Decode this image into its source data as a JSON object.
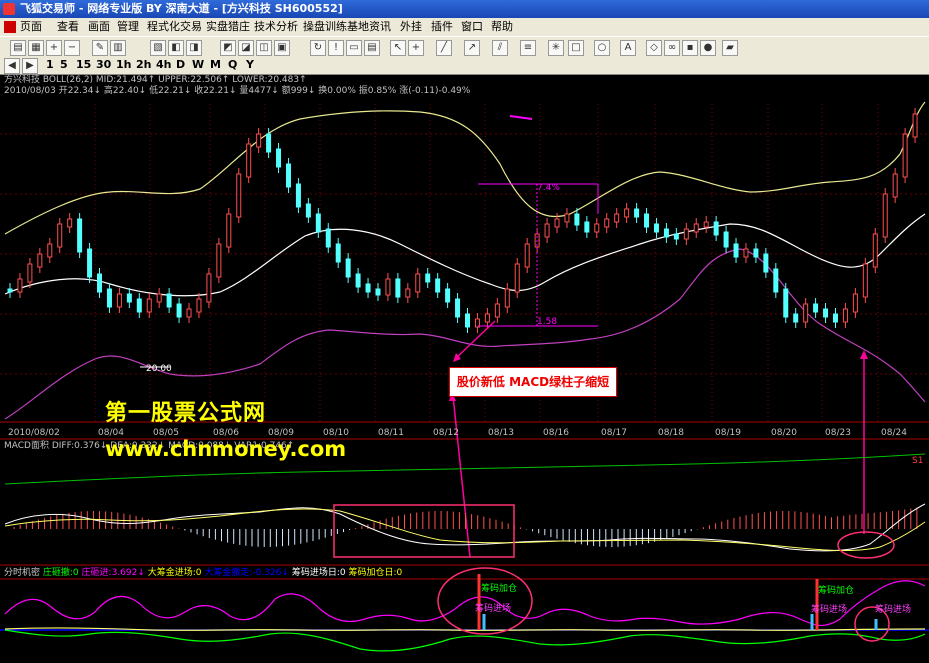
{
  "window": {
    "title": "飞狐交易师 - 网络专业版 BY 深南大道 - [方兴科技 SH600552]"
  },
  "menu": [
    "页面",
    "查看",
    "画面",
    "管理",
    "程式化交易",
    "实盘猎庄",
    "技术分析",
    "操盘训练基地",
    "资讯",
    "外挂",
    "插件",
    "窗口",
    "帮助"
  ],
  "toolbar": {
    "periods": [
      "1",
      "5",
      "15",
      "30",
      "1h",
      "2h",
      "4h",
      "D",
      "W",
      "M",
      "Q",
      "Y"
    ],
    "buttons": [
      "open-icon",
      "print-icon",
      "zoom-in-icon",
      "zoom-out-icon",
      "drawing-icon",
      "cursor-icon",
      "line-icon",
      "text-icon",
      "rect-icon",
      "ellipse-icon",
      "font-icon",
      "eraser-icon",
      "save-icon"
    ]
  },
  "main_panel": {
    "line1": "方兴科技 BOLL(26,2) MID:21.494↑ UPPER:22.506↑ LOWER:20.483↑",
    "line2": "2010/08/03 开22.34↓ 高22.40↓ 低22.21↓ 收22.21↓ 量4477↓ 额999↓ 换0.00% 振0.85% 涨(-0.11)-0.49%",
    "label_high_pct": "7.4%",
    "label_low_price": "1.58",
    "label_min": "20.00",
    "dates": [
      "2010/08/02",
      "08/04",
      "08/05",
      "08/06",
      "08/09",
      "08/10",
      "08/11",
      "08/12",
      "08/13",
      "08/16",
      "08/17",
      "08/18",
      "08/19",
      "08/20",
      "08/23",
      "08/24"
    ]
  },
  "macd_panel": {
    "header": "MACD面积 DIFF:0.376↓ DEA:0.332↓ MACD:0.088↓ VAR1:0.746↑",
    "right_label": "S1"
  },
  "flow_panel": {
    "header_parts": [
      {
        "text": "分时机密",
        "color": "#cccccc"
      },
      {
        "text": "庄砸撤:0",
        "color": "#00ff00"
      },
      {
        "text": "庄砸进:3.692↓",
        "color": "#ff00ff"
      },
      {
        "text": "大筹金进场:0",
        "color": "#ffff00"
      },
      {
        "text": "大筹金撤走:-0.326↓",
        "color": "#0000ff"
      },
      {
        "text": "筹码进场日:0",
        "color": "#ffffff"
      },
      {
        "text": "筹码加仓日:0",
        "color": "#ffff00"
      }
    ],
    "annotations": [
      "筹码加仓",
      "筹码进场",
      "筹码加仓",
      "筹码进场",
      "筹码进场"
    ]
  },
  "overlays": {
    "watermark_title": "第一股票公式网",
    "watermark_url": "www.chnmoney.com",
    "callout": "股价新低 MACD绿柱子缩短"
  },
  "colors": {
    "up": "#ff5050",
    "down": "#54ffff",
    "mid_line": "#ffffff",
    "upper_line": "#e8e890",
    "lower_line": "#c040c0",
    "accent_magenta": "#ff00c0"
  }
}
